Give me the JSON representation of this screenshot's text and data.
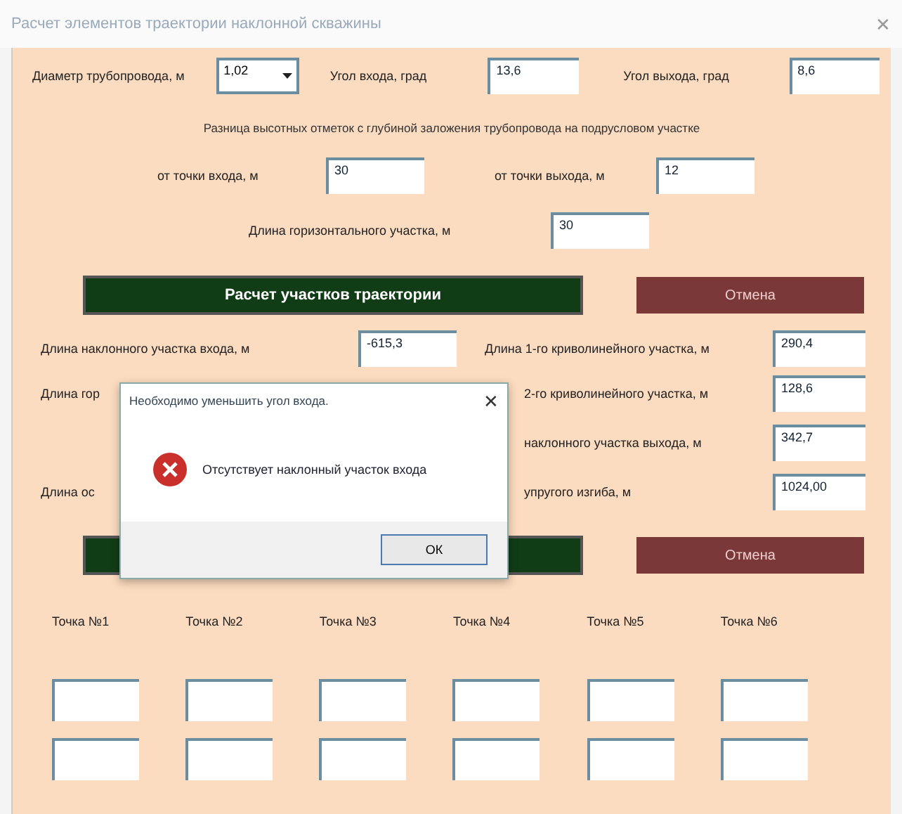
{
  "window": {
    "title": "Расчет элементов траектории наклонной скважины",
    "close": "✕"
  },
  "inputs": {
    "diameter": {
      "label": "Диаметр трубопровода, м",
      "value": "1,02"
    },
    "entry_angle": {
      "label": "Угол входа, град",
      "value": "13,6"
    },
    "exit_angle": {
      "label": "Угол выхода, град",
      "value": "8,6"
    },
    "depth_caption": "Разница высотных отметок с глубиной заложения трубопровода на подрусловом участке",
    "from_entry": {
      "label": "от точки входа, м",
      "value": "30"
    },
    "from_exit": {
      "label": "от точки выхода, м",
      "value": "12"
    },
    "horizontal": {
      "label": "Длина горизонтального участка, м",
      "value": "30"
    }
  },
  "buttons": {
    "calculate": "Расчет участков траектории",
    "cancel": "Отмена"
  },
  "results": [
    {
      "left_label": "Длина наклонного участка входа, м",
      "left_value": "-615,3",
      "right_label": "Длина 1-го криволинейного участка, м",
      "right_value": "290,4"
    },
    {
      "left_label": "Длина гор",
      "right_label": "2-го криволинейного участка, м",
      "right_value": "128,6"
    },
    {
      "right_label": "наклонного участка выхода, м",
      "right_value": "342,7"
    },
    {
      "left_label": "Длина ос",
      "right_label": "упругого изгиба, м",
      "right_value": "1024,00"
    }
  ],
  "buttons2": {
    "cancel": "Отмена"
  },
  "points": [
    "Точка №1",
    "Точка №2",
    "Точка №3",
    "Точка №4",
    "Точка №5",
    "Точка №6"
  ],
  "dialog": {
    "title": "Необходимо уменьшить угол входа.",
    "close": "✕",
    "message": "Отсутствует наклонный участок входа",
    "ok": "ОК"
  }
}
